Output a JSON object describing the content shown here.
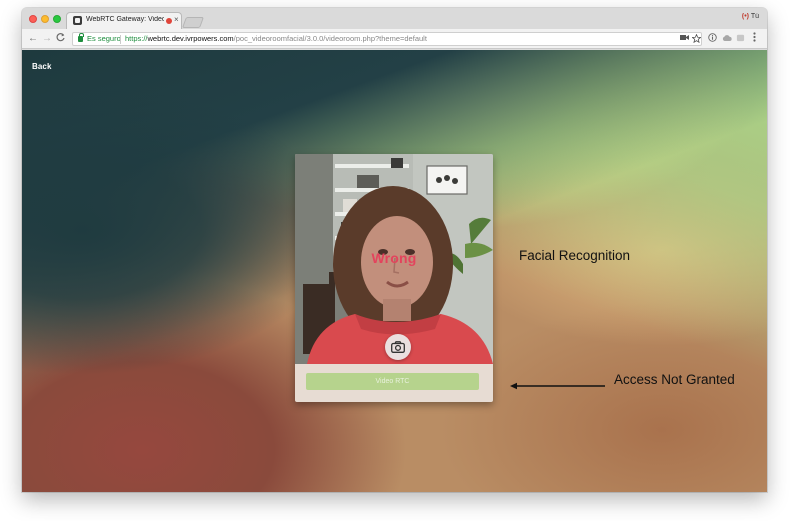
{
  "browser": {
    "tab": {
      "title": "WebRTC Gateway: Video Ro",
      "close": "×"
    },
    "profile": {
      "icon": "(•)",
      "name": "Tú"
    },
    "nav": {
      "back": "←",
      "forward": "→",
      "reload": "C"
    },
    "address": {
      "secure_label": "Es seguro",
      "scheme": "https://",
      "host": "webrtc.dev.ivrpowers.com",
      "path": "/poc_videoroomfacial/3.0.0/videoroom.php?theme=default"
    },
    "icons": [
      "video-camera-icon",
      "star-icon",
      "extension-icon",
      "extension-icon",
      "extension-icon",
      "menu-icon"
    ]
  },
  "page": {
    "back_label": "Back",
    "card": {
      "status_text": "Wrong",
      "button_label": "Video RTC"
    },
    "annotations": {
      "facial": "Facial Recognition",
      "access": "Access Not Granted"
    },
    "colors": {
      "status": "#e3445d",
      "button": "#b6d38d"
    }
  }
}
